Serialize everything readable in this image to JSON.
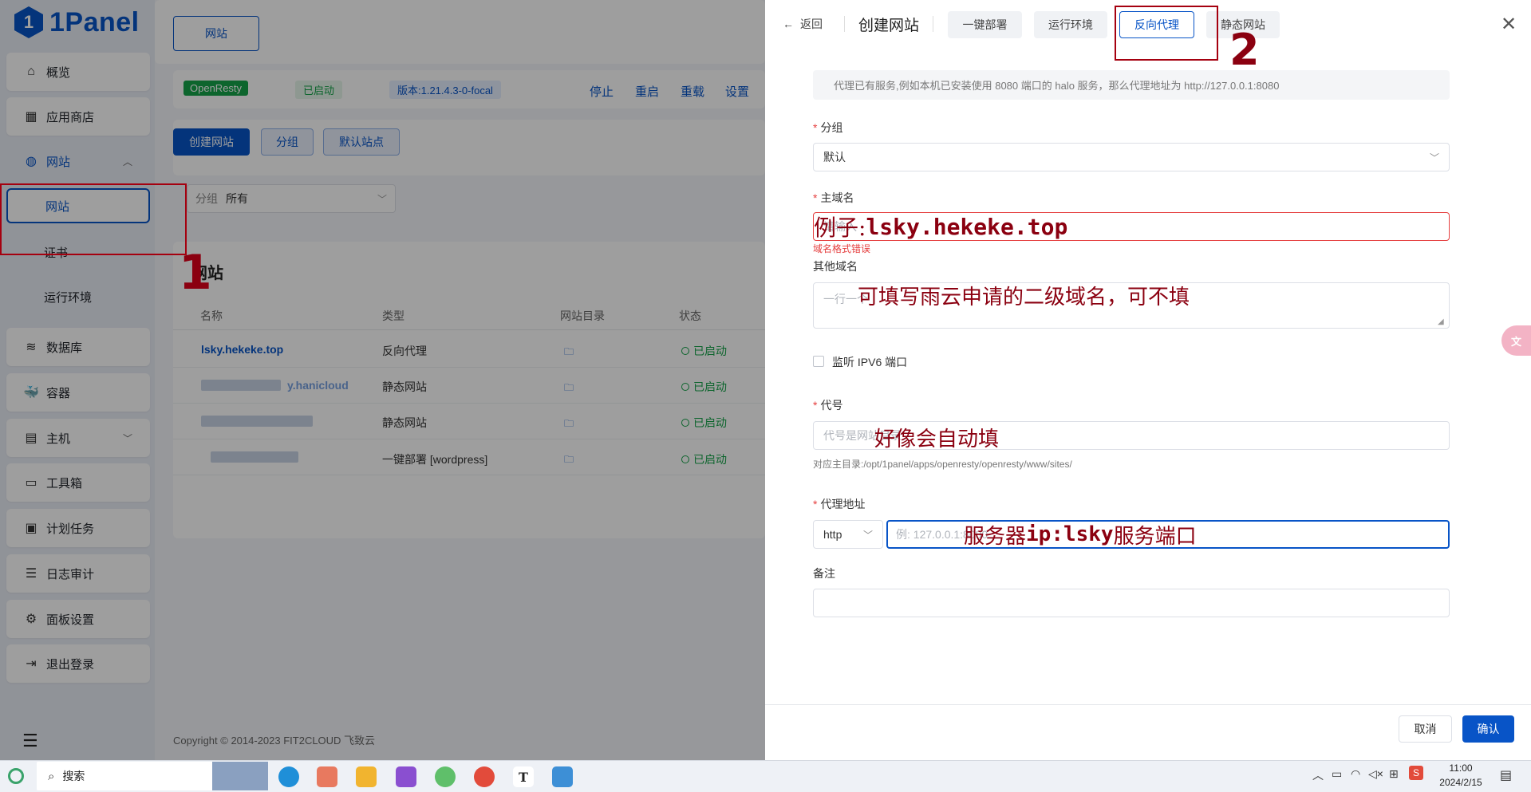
{
  "sidebar": {
    "brand": "1Panel",
    "brand_letter": "1",
    "items": [
      {
        "label": "概览",
        "icon": "home-icon"
      },
      {
        "label": "应用商店",
        "icon": "grid-icon"
      },
      {
        "label": "网站",
        "icon": "globe-icon"
      },
      {
        "label": "数据库",
        "icon": "layers-icon"
      },
      {
        "label": "容器",
        "icon": "docker-icon"
      },
      {
        "label": "主机",
        "icon": "server-icon"
      },
      {
        "label": "工具箱",
        "icon": "toolbox-icon"
      },
      {
        "label": "计划任务",
        "icon": "calendar-icon"
      },
      {
        "label": "日志审计",
        "icon": "log-icon"
      },
      {
        "label": "面板设置",
        "icon": "gear-icon"
      },
      {
        "label": "退出登录",
        "icon": "logout-icon"
      }
    ],
    "sub_items": [
      "网站",
      "证书",
      "运行环境"
    ],
    "collapse_icon": "menu-collapse-icon"
  },
  "main": {
    "top_tab": "网站",
    "server": {
      "name": "OpenResty",
      "status": "已启动",
      "version": "版本:1.21.4.3-0-focal",
      "actions": [
        "停止",
        "重启",
        "重载",
        "设置"
      ]
    },
    "buttons": {
      "create": "创建网站",
      "group": "分组",
      "default_site": "默认站点"
    },
    "filter": {
      "label": "分组",
      "value": "所有"
    },
    "section_title": "网站",
    "table": {
      "headers": [
        "名称",
        "类型",
        "网站目录",
        "状态"
      ],
      "rows": [
        {
          "name": "lsky.hekeke.top",
          "type": "反向代理",
          "status": "已启动"
        },
        {
          "name": "y.hanicloud",
          "type": "静态网站",
          "status": "已启动"
        },
        {
          "name": "",
          "type": "静态网站",
          "status": "已启动"
        },
        {
          "name": "",
          "type": "一键部署 [wordpress]",
          "status": "已启动"
        }
      ]
    },
    "footer": "Copyright © 2014-2023 FIT2CLOUD 飞致云"
  },
  "drawer": {
    "back": "返回",
    "title": "创建网站",
    "tabs": [
      "一键部署",
      "运行环境",
      "反向代理",
      "静态网站"
    ],
    "active_tab": "反向代理",
    "info": "代理已有服务,例如本机已安装使用 8080 端口的 halo 服务，那么代理地址为 http://127.0.0.1:8080",
    "group_label": "分组",
    "group_value": "默认",
    "domain_label": "主域名",
    "domain_placeholder": "请输入",
    "domain_error": "域名格式错误",
    "other_domain_label": "其他域名",
    "other_domain_placeholder": "一行一个",
    "ipv6_label": "监听 IPV6 端口",
    "alias_label": "代号",
    "alias_placeholder": "代号是网站目录",
    "alias_hint": "对应主目录:/opt/1panel/apps/openresty/openresty/www/sites/",
    "proxy_label": "代理地址",
    "proxy_scheme": "http",
    "proxy_placeholder": "例: 127.0.0.1:8080",
    "remark_label": "备注",
    "cancel": "取消",
    "confirm": "确认"
  },
  "annotations": {
    "n1": "1",
    "n2": "2",
    "domain_example_prefix": "例子: ",
    "domain_example": "lsky.hekeke.top",
    "other_domain_note": "可填写雨云申请的二级域名，可不填",
    "alias_note": "好像会自动填",
    "proxy_note_a": "服务器",
    "proxy_note_b": "ip:lsky",
    "proxy_note_c": "服务端口"
  },
  "taskbar": {
    "search": "搜索",
    "time": "11:00",
    "date": "2024/2/15"
  },
  "colors": {
    "brand": "#0854c7",
    "success": "#16a34a",
    "annotation": "#8b0010",
    "error": "#e53e3e"
  }
}
